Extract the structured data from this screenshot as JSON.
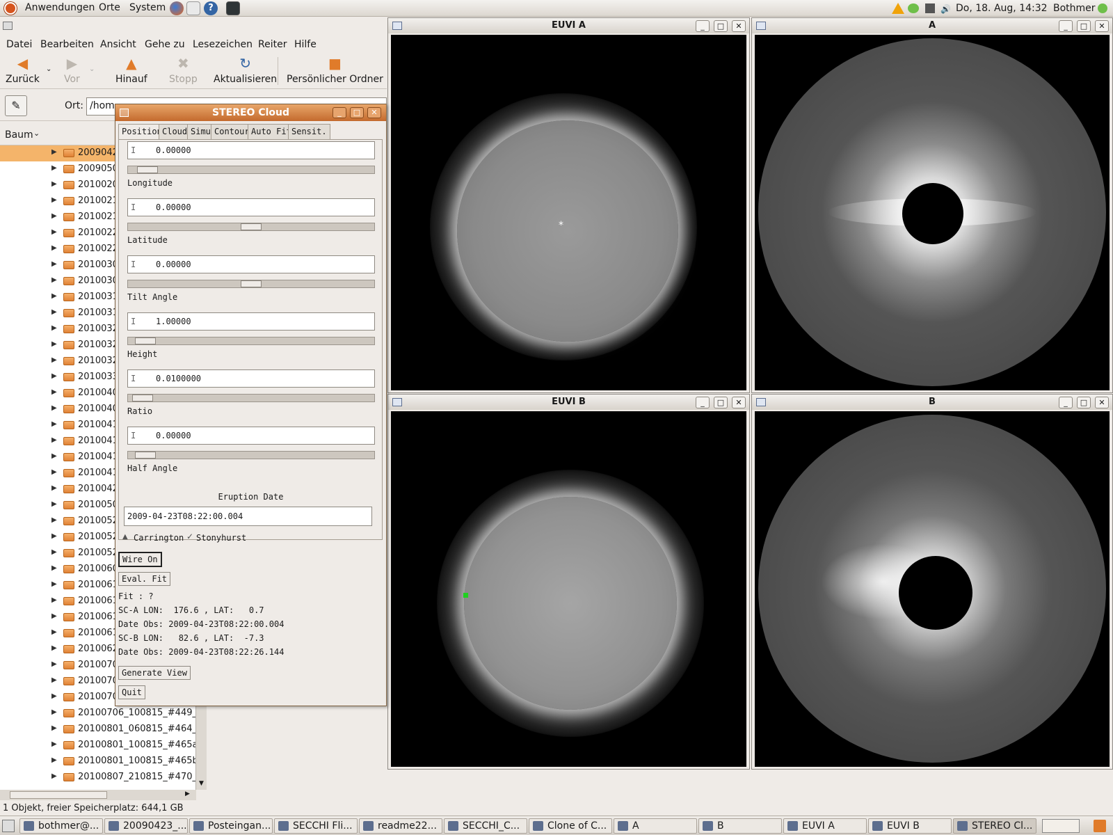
{
  "top_panel": {
    "menus": [
      "Anwendungen",
      "Orte",
      "System"
    ],
    "clock": "Do, 18. Aug, 14:32",
    "user": "Bothmer"
  },
  "file_manager": {
    "menus": [
      "Datei",
      "Bearbeiten",
      "Ansicht",
      "Gehe zu",
      "Lesezeichen",
      "Reiter",
      "Hilfe"
    ],
    "toolbar": {
      "back": "Zurück",
      "forward": "Vor",
      "up": "Hinauf",
      "stop": "Stopp",
      "reload": "Aktualisieren",
      "home": "Persönlicher Ordner"
    },
    "location_label": "Ort:",
    "location_value": "/hom",
    "sidebar_mode": "Baum",
    "tree_items": [
      "2009042",
      "2009050",
      "2010020",
      "2010021",
      "2010021",
      "2010022",
      "2010022",
      "2010030",
      "2010030",
      "2010031",
      "2010031",
      "2010032",
      "2010032",
      "2010032",
      "2010033",
      "2010040",
      "2010040",
      "2010041",
      "2010041",
      "2010041",
      "2010041",
      "2010042",
      "2010050",
      "2010052",
      "2010052",
      "2010052",
      "2010060",
      "2010061",
      "2010061",
      "2010061",
      "2010061",
      "2010062",
      "2010070",
      "2010070",
      "2010070",
      "20100706_100815_#449_",
      "20100801_060815_#464_",
      "20100801_100815_#465a",
      "20100801_100815_#465b",
      "20100807_210815_#470_"
    ],
    "status": "1 Objekt, freier Speicherplatz: 644,1 GB"
  },
  "windows": {
    "euvi_a": "EUVI A",
    "cor_a": "A",
    "euvi_b": "EUVI B",
    "cor_b": "B"
  },
  "dialog": {
    "title": "STEREO Cloud",
    "tabs": [
      "Position",
      "Cloud",
      "Simu",
      "Contour",
      "Auto Fit",
      "Sensit."
    ],
    "fields": [
      {
        "label": "Longitude",
        "value": "0.00000",
        "level": 0.04
      },
      {
        "label": "Latitude",
        "value": "0.00000",
        "level": 0.5
      },
      {
        "label": "Tilt Angle",
        "value": "0.00000",
        "level": 0.5
      },
      {
        "label": "Height",
        "value": "1.00000",
        "level": 0.03
      },
      {
        "label": "Ratio",
        "value": "0.0100000",
        "level": 0.02
      },
      {
        "label": "Half Angle",
        "value": "0.00000",
        "level": 0.03
      }
    ],
    "eruption_label": "Eruption Date",
    "eruption_value": "2009-04-23T08:22:00.004",
    "radio_carrington": "Carrington",
    "radio_stonyhurst": "Stonyhurst",
    "wire_button": "Wire On",
    "eval_button": "Eval. Fit",
    "fit_text": "Fit : ?",
    "sca_text": "SC-A LON:  176.6 , LAT:   0.7",
    "date_a": "Date Obs: 2009-04-23T08:22:00.004",
    "scb_text": "SC-B LON:   82.6 , LAT:  -7.3",
    "date_b": "Date Obs: 2009-04-23T08:22:26.144",
    "generate_button": "Generate View",
    "quit_button": "Quit"
  },
  "taskbar": [
    "bothmer@...",
    "20090423_...",
    "Posteingan...",
    "SECCHI Fli...",
    "readme22...",
    "SECCHI_C...",
    "Clone of C...",
    "A",
    "B",
    "EUVI A",
    "EUVI B",
    "STEREO Cl..."
  ]
}
